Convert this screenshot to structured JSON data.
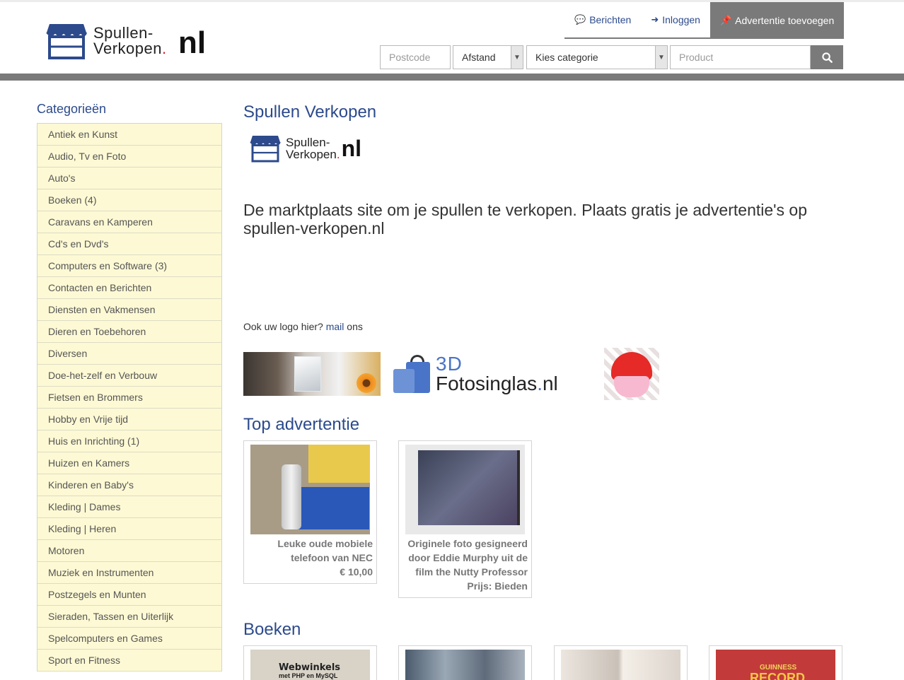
{
  "header": {
    "logo": {
      "line1": "Spullen-",
      "line2": "Verkopen",
      "dot": ".",
      "tld": "nl"
    },
    "nav": [
      {
        "label": "Berichten",
        "icon": "comments-icon"
      },
      {
        "label": "Inloggen",
        "icon": "sign-in-icon"
      },
      {
        "label": "Advertentie toevoegen",
        "icon": "thumbtack-icon"
      }
    ],
    "search": {
      "postcode_placeholder": "Postcode",
      "distance_value": "Afstand",
      "category_value": "Kies categorie",
      "product_placeholder": "Product",
      "search_icon": "search-icon"
    }
  },
  "sidebar": {
    "title": "Categorieën",
    "items": [
      "Antiek en Kunst",
      "Audio, Tv en Foto",
      "Auto's",
      "Boeken (4)",
      "Caravans en Kamperen",
      "Cd's en Dvd's",
      "Computers en Software (3)",
      "Contacten en Berichten",
      "Diensten en Vakmensen",
      "Dieren en Toebehoren",
      "Diversen",
      "Doe-het-zelf en Verbouw",
      "Fietsen en Brommers",
      "Hobby en Vrije tijd",
      "Huis en Inrichting (1)",
      "Huizen en Kamers",
      "Kinderen en Baby's",
      "Kleding | Dames",
      "Kleding | Heren",
      "Motoren",
      "Muziek en Instrumenten",
      "Postzegels en Munten",
      "Sieraden, Tassen en Uiterlijk",
      "Spelcomputers en Games",
      "Sport en Fitness"
    ]
  },
  "main": {
    "title": "Spullen Verkopen",
    "intro": "De marktplaats site om je spullen te verkopen. Plaats gratis je advertentie's op spullen-verkopen.nl",
    "ook": {
      "before": "Ook uw logo hier? ",
      "link": "mail",
      "after": " ons"
    },
    "banner_foto": {
      "prefix": "3D",
      "name": "Fotosinglas",
      "dot": ".",
      "tld": "nl"
    },
    "top": {
      "title": "Top advertentie",
      "cards": [
        {
          "title": "Leuke oude mobiele telefoon van NEC",
          "price": "€ 10,00"
        },
        {
          "title": "Originele foto gesigneerd door Eddie Murphy uit de film the Nutty Professor",
          "price": "Prijs: Bieden"
        }
      ]
    },
    "boeken": {
      "title": "Boeken",
      "webwinkels_title": "Webwinkels",
      "webwinkels_sub": "met PHP en MySQL",
      "guinness_top": "GUINNESS",
      "guinness_main": "RECORD"
    }
  },
  "colors": {
    "accent": "#2c4a8c",
    "bar": "#7a7a7a",
    "sidebar_bg": "#fdf9d4"
  }
}
